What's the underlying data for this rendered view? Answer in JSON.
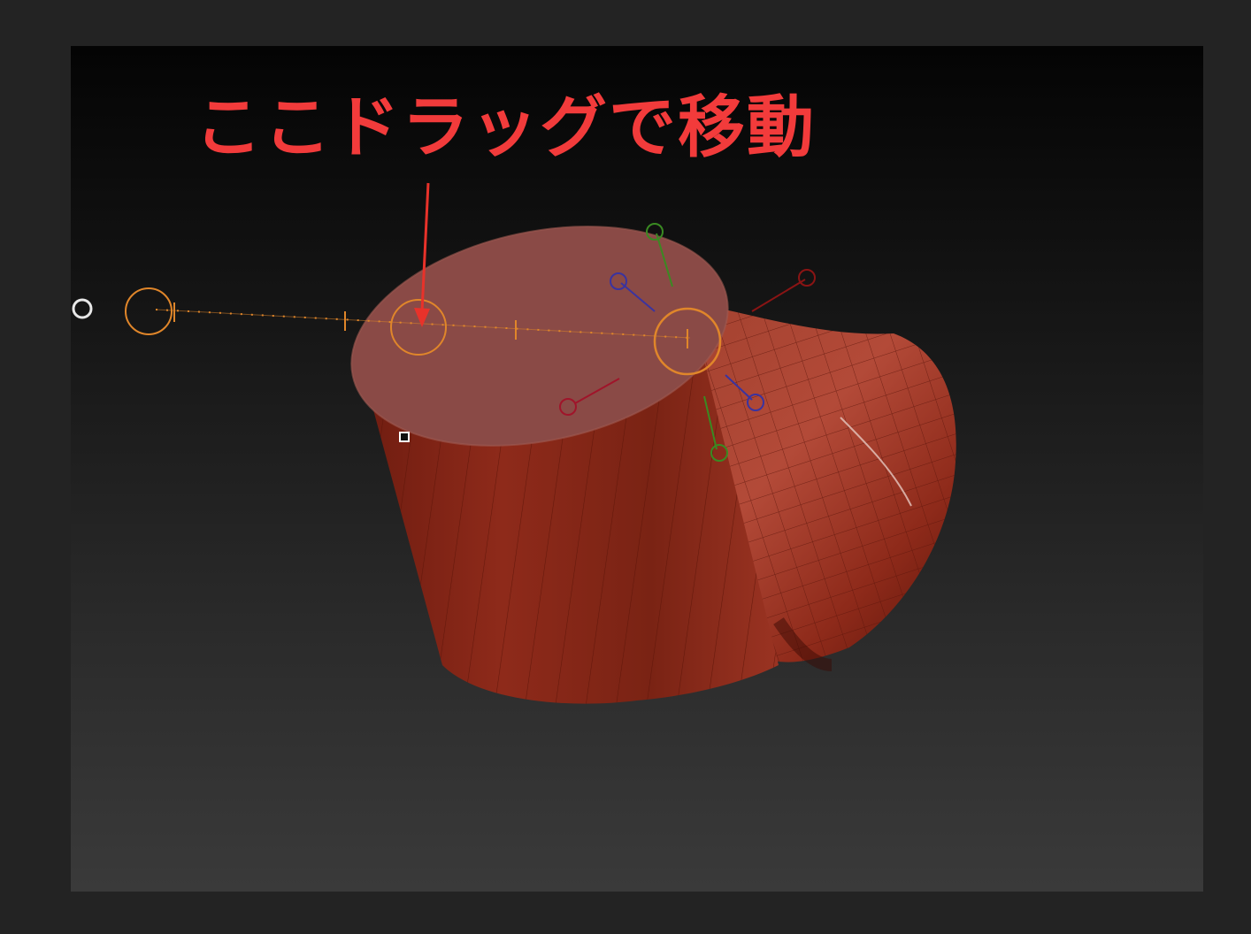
{
  "annotation": {
    "text": "ここドラッグで移動",
    "color": "#f23b3b"
  },
  "scene": {
    "mesh_color": "#8e2a1a",
    "mesh_top_color": "#8a4a46",
    "gizmo_color": "#e0862a",
    "axis_colors": {
      "x": "#8a1414",
      "y": "#3a8a22",
      "z": "#3a33a0"
    }
  }
}
